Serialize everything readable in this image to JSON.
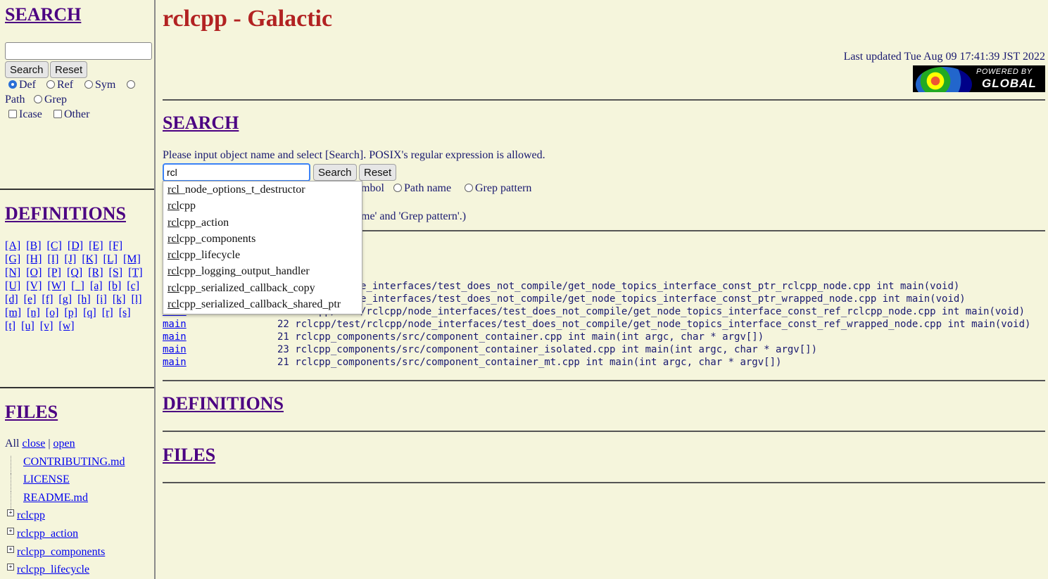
{
  "left": {
    "search": {
      "title": "SEARCH",
      "input_value": "",
      "search_label": "Search",
      "reset_label": "Reset",
      "options": {
        "def": "Def",
        "ref": "Ref",
        "sym": "Sym",
        "path": "Path",
        "grep": "Grep",
        "icase": "Icase",
        "other": "Other"
      },
      "selected": "Def"
    },
    "definitions": {
      "title": "DEFINITIONS",
      "letters": [
        "[A]",
        "[B]",
        "[C]",
        "[D]",
        "[E]",
        "[F]",
        "[G]",
        "[H]",
        "[I]",
        "[J]",
        "[K]",
        "[L]",
        "[M]",
        "[N]",
        "[O]",
        "[P]",
        "[Q]",
        "[R]",
        "[S]",
        "[T]",
        "[U]",
        "[V]",
        "[W]",
        "[_]",
        "[a]",
        "[b]",
        "[c]",
        "[d]",
        "[e]",
        "[f]",
        "[g]",
        "[h]",
        "[i]",
        "[k]",
        "[l]",
        "[m]",
        "[n]",
        "[o]",
        "[p]",
        "[q]",
        "[r]",
        "[s]",
        "[t]",
        "[u]",
        "[v]",
        "[w]"
      ]
    },
    "files": {
      "title": "FILES",
      "all_label": "All",
      "close_label": "close",
      "sep": "|",
      "open_label": "open",
      "leaves": [
        "CONTRIBUTING.md",
        "LICENSE",
        "README.md"
      ],
      "dirs": [
        "rclcpp",
        "rclcpp_action",
        "rclcpp_components",
        "rclcpp_lifecycle"
      ]
    }
  },
  "main": {
    "title": "rclcpp - Galactic",
    "last_updated": "Last updated Tue Aug 09 17:41:39 JST 2022",
    "badge": {
      "powered": "POWERED BY",
      "name": "GLOBAL"
    },
    "search": {
      "title": "SEARCH",
      "instructions": "Please input object name and select [Search]. POSIX's regular expression is allowed.",
      "input_value": "rcl",
      "search_label": "Search",
      "reset_label": "Reset",
      "options_visible": "mbol",
      "path_name": "Path name",
      "grep_pattern": "Grep pattern",
      "note_fragment": "me' and 'Grep pattern'.)"
    },
    "suggestions": [
      {
        "match": "rcl",
        "rest": "_node_options_t_destructor"
      },
      {
        "match": "rcl",
        "rest": "cpp"
      },
      {
        "match": "rcl",
        "rest": "cpp_action"
      },
      {
        "match": "rcl",
        "rest": "cpp_components"
      },
      {
        "match": "rcl",
        "rest": "cpp_lifecycle"
      },
      {
        "match": "rcl",
        "rest": "cpp_logging_output_handler"
      },
      {
        "match": "rcl",
        "rest": "cpp_serialized_callback_copy"
      },
      {
        "match": "rcl",
        "rest": "cpp_serialized_callback_shared_ptr"
      }
    ],
    "results": [
      {
        "name": "",
        "line": "   /rclcpp/node_interfaces/test_does_not_compile/get_node_topics_interface_const_ptr_rclcpp_node.cpp int main(void)"
      },
      {
        "name": "",
        "line": "   /rclcpp/node_interfaces/test_does_not_compile/get_node_topics_interface_const_ptr_wrapped_node.cpp int main(void)"
      },
      {
        "name": "main",
        "line": "20 rclcpp/test/rclcpp/node_interfaces/test_does_not_compile/get_node_topics_interface_const_ref_rclcpp_node.cpp int main(void)"
      },
      {
        "name": "main",
        "line": "22 rclcpp/test/rclcpp/node_interfaces/test_does_not_compile/get_node_topics_interface_const_ref_wrapped_node.cpp int main(void)"
      },
      {
        "name": "main",
        "line": "21 rclcpp_components/src/component_container.cpp int main(int argc, char * argv[])"
      },
      {
        "name": "main",
        "line": "23 rclcpp_components/src/component_container_isolated.cpp int main(int argc, char * argv[])"
      },
      {
        "name": "main",
        "line": "21 rclcpp_components/src/component_container_mt.cpp int main(int argc, char * argv[])"
      }
    ],
    "definitions_title": "DEFINITIONS",
    "files_title": "FILES"
  }
}
